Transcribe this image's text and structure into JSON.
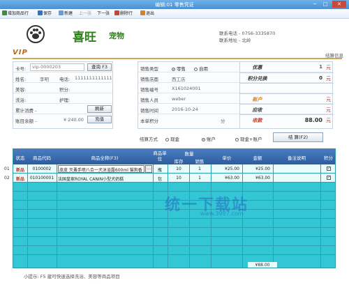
{
  "window": {
    "title": "编辑:01 零售凭证"
  },
  "toolbar": {
    "add_row": "增加商品行",
    "save": "保存",
    "new": "新建",
    "prev": "上一张",
    "next": "下一张",
    "delete_row": "删除行",
    "exit": "退出"
  },
  "header": {
    "brand_main": "喜旺",
    "brand_sub": "宠物",
    "phone_label": "联系电话 - 0756-3335870",
    "address_label": "联系地址 - 北岭",
    "vip": "VIP",
    "settle_info": "结算信息"
  },
  "member": {
    "card_label": "卡号:",
    "card_value": "vip-0000203",
    "query_button": "查询 F3",
    "name_label": "姓名:",
    "name_value": "李明",
    "phone_label": "电话:",
    "phone_value": "1111111111111",
    "beauty_label": "美容:",
    "points_label": "积分:",
    "bath_label": "洗浴:",
    "care_label": "护理:",
    "accum_label": "累计消费 -",
    "refresh_button": "刷新",
    "balance_label": "账目余额 -",
    "balance_value": "¥ 240.00",
    "recharge_button": "充值"
  },
  "sale": {
    "type_label": "销售类型",
    "type_retail": "零售",
    "type_self": "自用",
    "store_label": "销售店面",
    "store_value": "西工店",
    "no_label": "销售编号",
    "no_value": "X161024001",
    "staff_label": "销售人员",
    "staff_value": "weber",
    "time_label": "销售时间",
    "time_value": "2016-10-24",
    "points_label": "本单积分",
    "points_unit": "分"
  },
  "summary": {
    "discount_label": "优惠",
    "discount_value": "1",
    "discount_unit": "元",
    "points_label": "积分兑换",
    "points_value": "0",
    "points_unit": "元",
    "account_label": "账户",
    "account_unit": "元",
    "receivable_label": "应收",
    "receivable_unit": "元",
    "received_label": "收款",
    "received_value": "88.00",
    "received_unit": "元"
  },
  "payment": {
    "label": "结算方式",
    "cash": "现金",
    "account": "账户",
    "cash_account": "现金+账户",
    "settle_button": "结 算(F2)"
  },
  "grid": {
    "headers": {
      "status": "状态",
      "code": "商品代码",
      "name": "商品全称(F3)",
      "unit": "商品单位",
      "qty": "数量",
      "stock": "库存",
      "sold": "销售",
      "price": "单价",
      "amount": "金额",
      "note": "备注说明",
      "points": "积分"
    },
    "rows": [
      {
        "no": "01",
        "status": "新品",
        "code": "0100002",
        "name": "皮皮 灭蚤手喷八合一犬沐浴露600ml 猫狗香",
        "unit": "瓶",
        "stock": "10",
        "sold": "1",
        "price": "¥25.00",
        "amount": "¥25.00",
        "checked": true
      },
      {
        "no": "02",
        "status": "新品",
        "code": "010100001",
        "name": "法国皇家ROYAL CANIN小型犬奶糕",
        "unit": "包",
        "stock": "10",
        "sold": "1",
        "price": "¥63.00",
        "amount": "¥63.00",
        "checked": true
      }
    ],
    "total": "¥88.00"
  },
  "hint": "小提示: F5 建可快速选择洗浴、美容等商品项目",
  "watermark": {
    "text": "统一下载站",
    "url": "www.3987.com"
  }
}
